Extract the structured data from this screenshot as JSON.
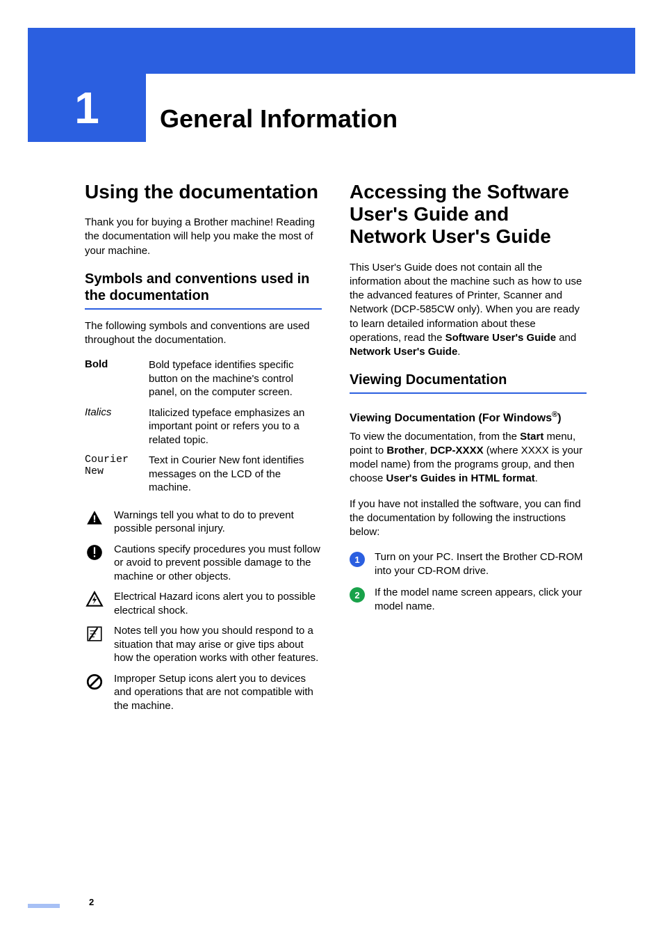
{
  "chapter": {
    "number": "1",
    "title": "General Information"
  },
  "left": {
    "h1": "Using the documentation",
    "intro": "Thank you for buying a Brother machine! Reading the documentation will help you make the most of your machine.",
    "h2": "Symbols and conventions used in the documentation",
    "para2": "The following symbols and conventions are used throughout the documentation.",
    "defs": [
      {
        "term": "Bold",
        "style": "bold",
        "desc": "Bold typeface identifies specific button on the machine's control panel, on the computer screen."
      },
      {
        "term": "Italics",
        "style": "italic",
        "desc": "Italicized typeface emphasizes an important point or refers you to a related topic."
      },
      {
        "term": "Courier New",
        "style": "mono",
        "desc": "Text in Courier New font identifies messages on the LCD of the machine."
      }
    ],
    "icons": [
      {
        "name": "warning-icon",
        "desc": "Warnings tell you what to do to prevent possible personal injury."
      },
      {
        "name": "caution-icon",
        "desc": "Cautions specify procedures you must follow or avoid to prevent possible damage to the machine or other objects."
      },
      {
        "name": "electrical-hazard-icon",
        "desc": "Electrical Hazard icons alert you to possible electrical shock."
      },
      {
        "name": "note-icon",
        "desc": "Notes tell you how you should respond to a situation that may arise or give tips about how the operation works with other features."
      },
      {
        "name": "improper-setup-icon",
        "desc": "Improper Setup icons alert you to devices and operations that are not compatible with the machine."
      }
    ]
  },
  "right": {
    "h1": "Accessing the Software User's Guide and Network User's Guide",
    "intro_pre": "This User's Guide does not contain all the information about the machine such as how to use the advanced features of Printer, Scanner and Network (DCP-585CW only). When you are ready to learn detailed information about these operations, read the ",
    "intro_b1": "Software User's Guide",
    "intro_mid": " and ",
    "intro_b2": "Network User's Guide",
    "intro_post": ".",
    "h2": "Viewing Documentation",
    "h3_pre": "Viewing Documentation (For Windows",
    "h3_sup": "®",
    "h3_post": ")",
    "p2_a": "To view the documentation, from the ",
    "p2_b1": "Start",
    "p2_b": " menu, point to ",
    "p2_b2": "Brother",
    "p2_c": ", ",
    "p2_b3": "DCP-XXXX",
    "p2_d": " (where XXXX is your model name) from the programs group, and then choose ",
    "p2_b4": "User's Guides in HTML format",
    "p2_e": ".",
    "p3": "If you have not installed the software, you can find the documentation by following the instructions below:",
    "steps": [
      {
        "n": "1",
        "text": "Turn on your PC. Insert the Brother CD-ROM into your CD-ROM drive."
      },
      {
        "n": "2",
        "text": "If the model name screen appears, click your model name."
      }
    ]
  },
  "page_number": "2"
}
